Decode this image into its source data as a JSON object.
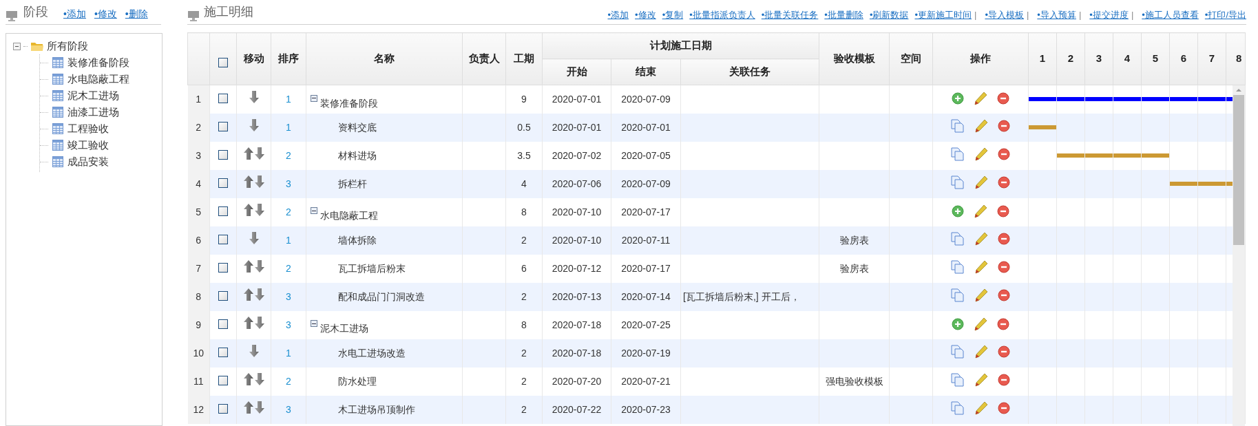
{
  "stage_panel": {
    "title": "阶段",
    "links": [
      "•添加",
      "•修改",
      "•删除"
    ],
    "tree": {
      "label": "所有阶段",
      "expanded": true,
      "children": [
        {
          "label": "装修准备阶段"
        },
        {
          "label": "水电隐蔽工程"
        },
        {
          "label": "泥木工进场"
        },
        {
          "label": "油漆工进场"
        },
        {
          "label": "工程验收"
        },
        {
          "label": "竣工验收"
        },
        {
          "label": "成品安装"
        }
      ]
    }
  },
  "detail_panel": {
    "title": "施工明细",
    "links": [
      {
        "label": "•添加"
      },
      {
        "label": "•修改"
      },
      {
        "label": "•复制"
      },
      {
        "label": "•批量指派负责人"
      },
      {
        "label": "•批量关联任务"
      },
      {
        "label": "•批量删除"
      },
      {
        "label": "•刷新数据"
      },
      {
        "label": "•更新施工时间",
        "separator": "|"
      },
      {
        "label": "•导入模板",
        "separator": "|"
      },
      {
        "label": "•导入预算",
        "separator": "|"
      },
      {
        "label": "•提交进度",
        "separator": "|"
      },
      {
        "label": "•施工人员查看"
      },
      {
        "label": "•打印/导出"
      }
    ]
  },
  "table": {
    "header_checkbox": {
      "checked": false
    },
    "columns_before": [
      "移动",
      "排序",
      "名称",
      "负责人",
      "工期"
    ],
    "date_group": {
      "title": "计划施工日期",
      "columns": [
        "开始",
        "结束",
        "关联任务"
      ]
    },
    "columns_after": [
      "验收模板",
      "空间",
      "操作"
    ],
    "days": [
      "1",
      "2",
      "3",
      "4",
      "5",
      "6",
      "7",
      "8"
    ],
    "rows": [
      {
        "number": "1",
        "checked": false,
        "move_up": false,
        "move_down": true,
        "order": "1",
        "kind": "stage",
        "expanded": true,
        "name": "装修准备阶段",
        "duration": "9",
        "start": "2020-07-01",
        "end": "2020-07-09",
        "gantt": [
          true,
          true,
          true,
          true,
          true,
          true,
          true,
          true
        ],
        "color": "#0000ff"
      },
      {
        "number": "2",
        "checked": false,
        "move_up": false,
        "move_down": true,
        "order": "1",
        "kind": "task",
        "name": "资料交底",
        "duration": "0.5",
        "start": "2020-07-01",
        "end": "2020-07-01",
        "gantt": [
          true,
          false,
          false,
          false,
          false,
          false,
          false,
          false
        ],
        "color": "#cc9933"
      },
      {
        "number": "3",
        "checked": false,
        "move_up": true,
        "move_down": true,
        "order": "2",
        "kind": "task",
        "name": "材料进场",
        "duration": "3.5",
        "start": "2020-07-02",
        "end": "2020-07-05",
        "gantt": [
          false,
          true,
          true,
          true,
          true,
          false,
          false,
          false
        ],
        "color": "#cc9933"
      },
      {
        "number": "4",
        "checked": false,
        "move_up": true,
        "move_down": true,
        "order": "3",
        "kind": "task",
        "name": "拆栏杆",
        "duration": "4",
        "start": "2020-07-06",
        "end": "2020-07-09",
        "gantt": [
          false,
          false,
          false,
          false,
          false,
          true,
          true,
          true
        ],
        "color": "#cc9933"
      },
      {
        "number": "5",
        "checked": false,
        "move_up": true,
        "move_down": true,
        "order": "2",
        "kind": "stage",
        "expanded": true,
        "name": "水电隐蔽工程",
        "duration": "8",
        "start": "2020-07-10",
        "end": "2020-07-17"
      },
      {
        "number": "6",
        "checked": false,
        "move_up": false,
        "move_down": true,
        "order": "1",
        "kind": "task",
        "name": "墙体拆除",
        "duration": "2",
        "start": "2020-07-10",
        "end": "2020-07-11",
        "template": "验房表"
      },
      {
        "number": "7",
        "checked": false,
        "move_up": true,
        "move_down": true,
        "order": "2",
        "kind": "task",
        "name": "瓦工拆墙后粉末",
        "duration": "6",
        "start": "2020-07-12",
        "end": "2020-07-17",
        "template": "验房表"
      },
      {
        "number": "8",
        "checked": false,
        "move_up": true,
        "move_down": true,
        "order": "3",
        "kind": "task",
        "name": "配和成品门门洞改造",
        "duration": "2",
        "start": "2020-07-13",
        "end": "2020-07-14",
        "related": "[瓦工拆墙后粉末,] 开工后，"
      },
      {
        "number": "9",
        "checked": false,
        "move_up": true,
        "move_down": true,
        "order": "3",
        "kind": "stage",
        "expanded": true,
        "name": "泥木工进场",
        "duration": "8",
        "start": "2020-07-18",
        "end": "2020-07-25"
      },
      {
        "number": "10",
        "checked": false,
        "move_up": false,
        "move_down": true,
        "order": "1",
        "kind": "task",
        "name": "水电工进场改造",
        "duration": "2",
        "start": "2020-07-18",
        "end": "2020-07-19"
      },
      {
        "number": "11",
        "checked": false,
        "move_up": true,
        "move_down": true,
        "order": "2",
        "kind": "task",
        "name": "防水处理",
        "duration": "2",
        "start": "2020-07-20",
        "end": "2020-07-21",
        "template": "强电验收模板"
      },
      {
        "number": "12",
        "checked": false,
        "move_up": true,
        "move_down": true,
        "order": "3",
        "kind": "task",
        "name": "木工进场吊顶制作",
        "duration": "2",
        "start": "2020-07-22",
        "end": "2020-07-23"
      }
    ]
  }
}
